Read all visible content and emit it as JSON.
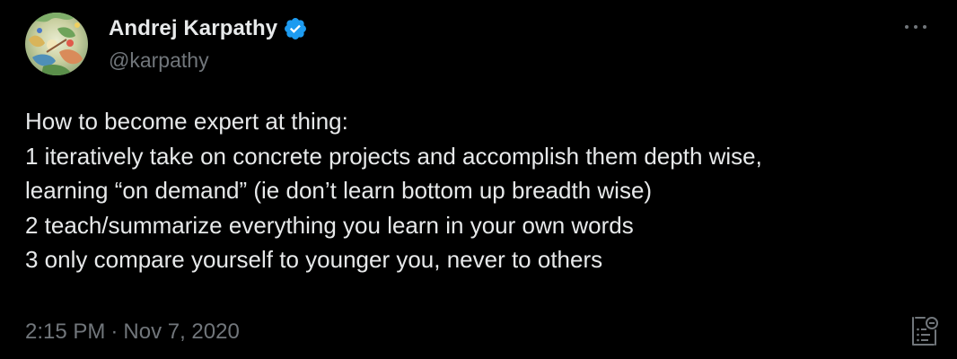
{
  "author": {
    "display_name": "Andrej Karpathy",
    "handle": "@karpathy",
    "verified": true,
    "avatar_icon": "avatar-painting"
  },
  "tweet": {
    "lines": [
      "How to become expert at thing:",
      "1 iteratively take on concrete projects and accomplish them depth wise,",
      "learning “on demand” (ie don’t learn bottom up breadth wise)",
      "2 teach/summarize everything you learn in your own words",
      "3 only compare yourself to younger you, never to others"
    ],
    "time": "2:15 PM",
    "separator": "·",
    "date": "Nov 7, 2020"
  },
  "icons": {
    "more": "more-icon",
    "verified": "verified-badge-icon",
    "grok": "grok-explain-icon"
  },
  "colors": {
    "background": "#000000",
    "text": "#e7e9ea",
    "secondary": "#71767b",
    "verified": "#1d9bf0"
  }
}
